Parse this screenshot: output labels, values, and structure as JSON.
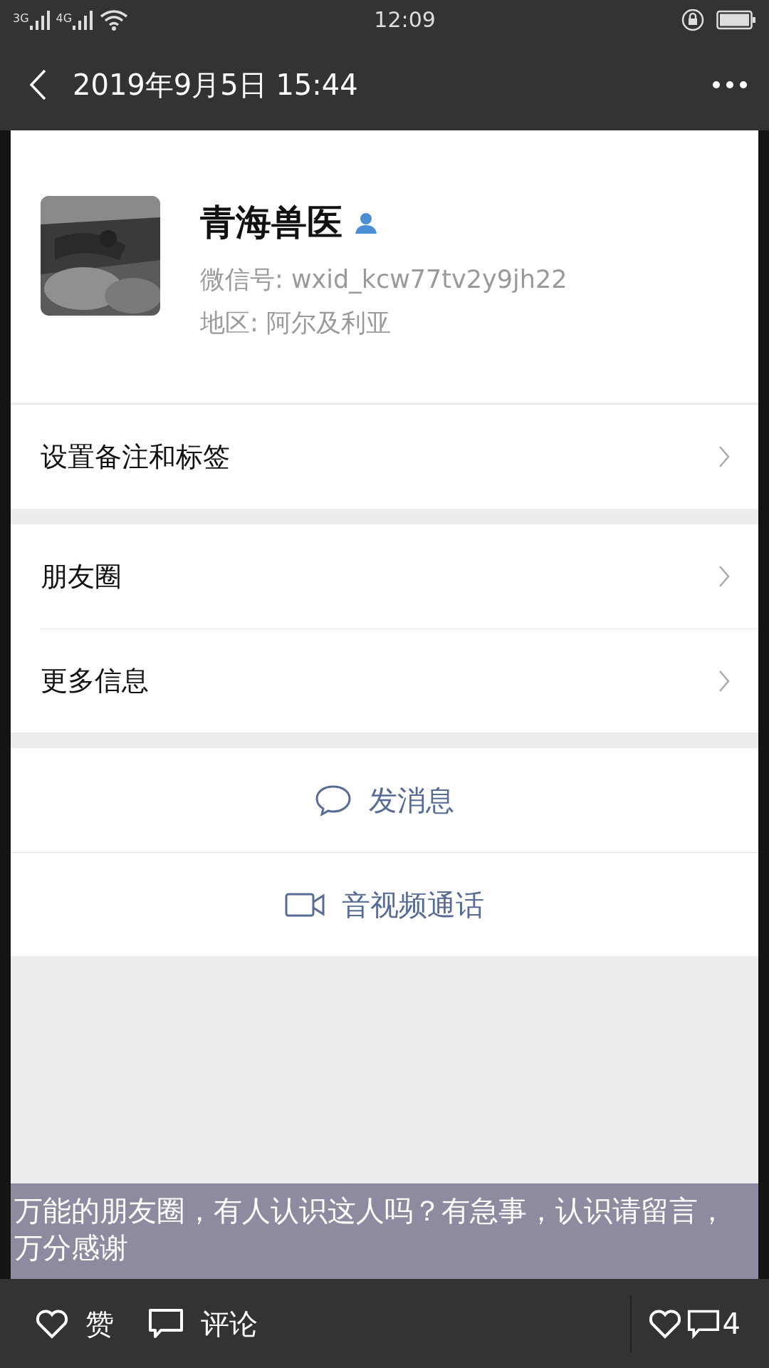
{
  "status_bar": {
    "network_1": "3G",
    "network_2": "4G",
    "time": "12:09"
  },
  "header": {
    "title": "2019年9月5日 15:44"
  },
  "profile": {
    "name": "青海兽医",
    "wechat_id": "微信号: wxid_kcw77tv2y9jh22",
    "region": "地区: 阿尔及利亚"
  },
  "menu_groups": [
    {
      "items": [
        {
          "label": "设置备注和标签"
        }
      ]
    },
    {
      "items": [
        {
          "label": "朋友圈"
        },
        {
          "label": "更多信息"
        }
      ]
    }
  ],
  "actions": [
    {
      "kind": "message",
      "label": "发消息"
    },
    {
      "kind": "video",
      "label": "音视频通话"
    }
  ],
  "caption": "万能的朋友圈，有人认识这人吗？有急事，认识请留言，万分感谢",
  "bottom_bar": {
    "like": "赞",
    "comment": "评论",
    "count": "4"
  }
}
